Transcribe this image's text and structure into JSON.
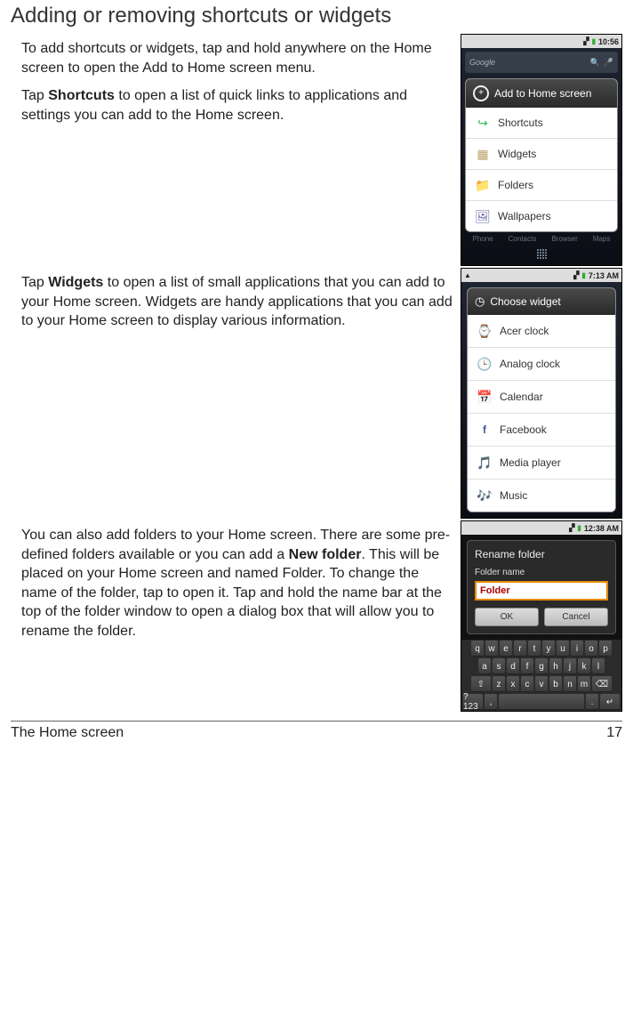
{
  "heading": "Adding or removing shortcuts or widgets",
  "sections": {
    "s1": {
      "p1": "To add shortcuts or widgets, tap and hold anywhere on the Home screen to open the Add to Home screen menu.",
      "p2_pre": "Tap ",
      "p2_bold": "Shortcuts",
      "p2_post": " to open a list of quick links to applications and settings you can add to the Home screen."
    },
    "s2": {
      "p1_pre": "Tap ",
      "p1_bold": "Widgets",
      "p1_post": " to open a list of small applications that you can add to your Home screen. Widgets are handy applications that you can add to your Home screen to display various information."
    },
    "s3": {
      "p1_pre": "You can also add folders to your Home screen. There are some pre-defined folders available or you can add a ",
      "p1_bold": "New folder",
      "p1_post": ". This will be placed on your Home screen and named Folder. To change the name of the folder, tap to open it. Tap and hold the name bar at the top of the folder window to open a dialog box that will allow you to rename the folder."
    }
  },
  "screenshot1": {
    "time": "10:56",
    "header": "Add to Home screen",
    "rows": [
      "Shortcuts",
      "Widgets",
      "Folders",
      "Wallpapers"
    ],
    "dock": [
      "Phone",
      "Contacts",
      "Browser",
      "Maps"
    ]
  },
  "screenshot2": {
    "time": "7:13 AM",
    "header": "Choose widget",
    "rows": [
      "Acer clock",
      "Analog clock",
      "Calendar",
      "Facebook",
      "Media player",
      "Music"
    ]
  },
  "screenshot3": {
    "time": "12:38 AM",
    "title": "Rename folder",
    "label": "Folder name",
    "value": "Folder",
    "ok": "OK",
    "cancel": "Cancel",
    "kbd": {
      "r1": [
        "q",
        "w",
        "e",
        "r",
        "t",
        "y",
        "u",
        "i",
        "o",
        "p"
      ],
      "r2": [
        "a",
        "s",
        "d",
        "f",
        "g",
        "h",
        "j",
        "k",
        "l"
      ],
      "r3": [
        "⇧",
        "z",
        "x",
        "c",
        "v",
        "b",
        "n",
        "m",
        "⌫"
      ],
      "r4": [
        "?123",
        ",",
        "␣",
        ".",
        "↵"
      ]
    }
  },
  "footer": {
    "left": "The Home screen",
    "right": "17"
  }
}
